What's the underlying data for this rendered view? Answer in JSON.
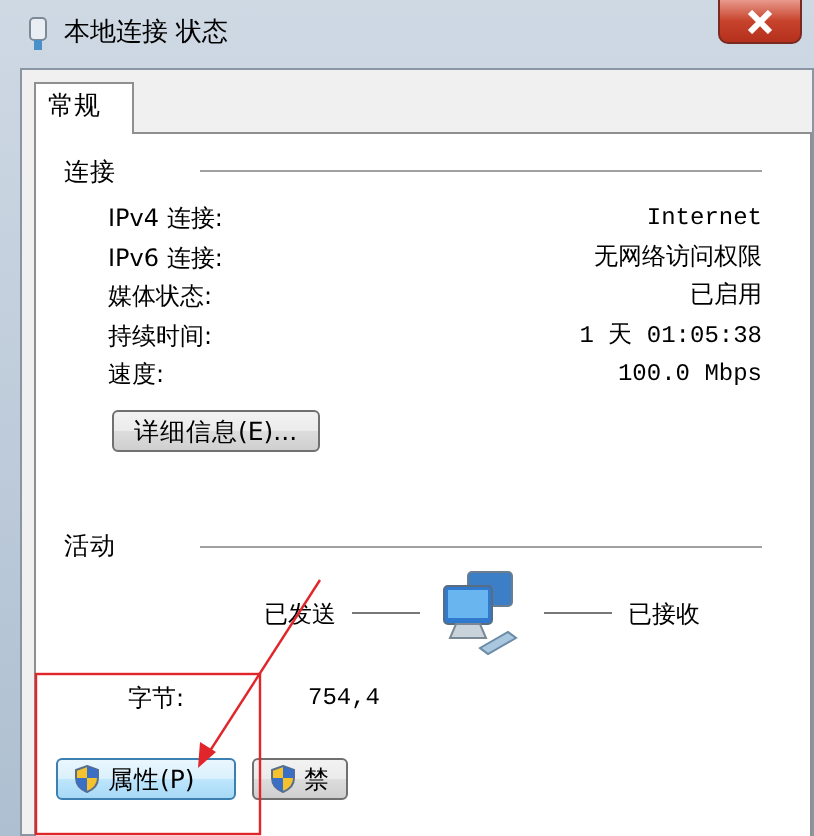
{
  "window": {
    "title": "本地连接 状态"
  },
  "tabs": [
    {
      "label": "常规",
      "selected": true
    }
  ],
  "connection": {
    "heading": "连接",
    "rows": [
      {
        "label": "IPv4 连接:",
        "value": "Internet"
      },
      {
        "label": "IPv6 连接:",
        "value": "无网络访问权限"
      },
      {
        "label": "媒体状态:",
        "value": "已启用"
      },
      {
        "label": "持续时间:",
        "value": "1 天 01:05:38"
      },
      {
        "label": "速度:",
        "value": "100.0 Mbps"
      }
    ],
    "details_button": "详细信息(E)..."
  },
  "activity": {
    "heading": "活动",
    "sent_label": "已发送",
    "received_label": "已接收",
    "bytes_label": "字节:",
    "bytes_sent": "754,4"
  },
  "buttons": [
    {
      "label": "属性(P)",
      "shield": true
    },
    {
      "label": "禁",
      "shield": true
    }
  ]
}
